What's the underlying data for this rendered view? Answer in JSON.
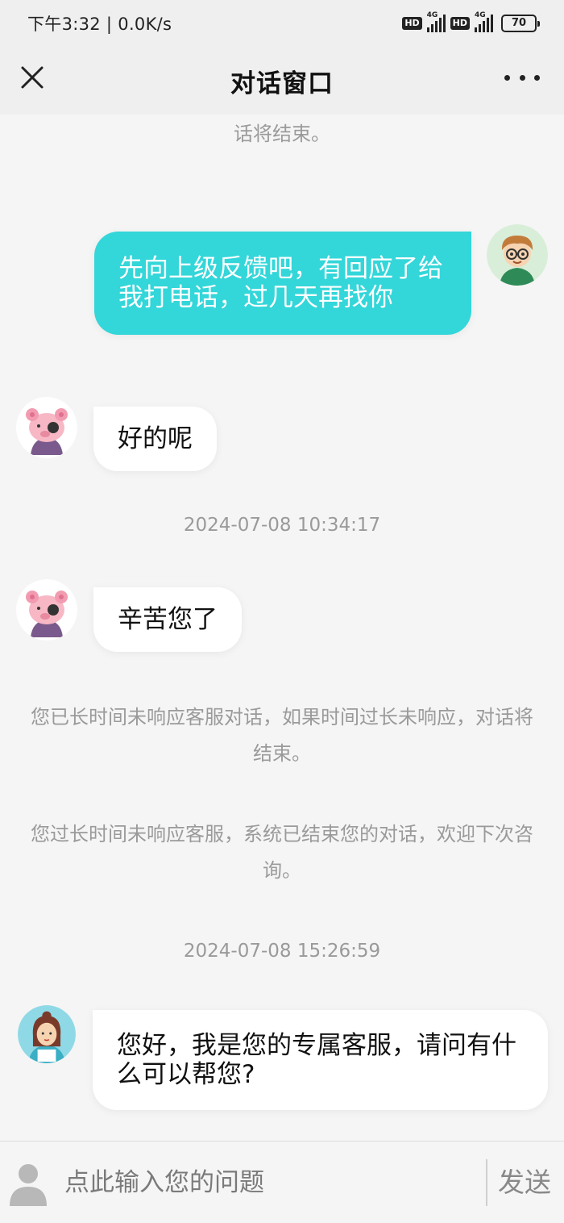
{
  "status_bar": {
    "time_speed": "下午3:32 | 0.0K/s",
    "hd_label": "HD",
    "network_label": "4G",
    "battery": "70"
  },
  "header": {
    "title": "对话窗口",
    "close_icon": "close-icon",
    "more_icon": "more-dots-icon"
  },
  "messages": {
    "sys_top": "话将结束。",
    "mine_1": "先向上级反馈吧，有回应了给我打电话，过几天再找你",
    "theirs_1": "好的呢",
    "time_1": "2024-07-08 10:34:17",
    "theirs_2": "辛苦您了",
    "sys_timeout_warning": "您已长时间未响应客服对话，如果时间过长未响应，对话将结束。",
    "sys_ended": "您过长时间未响应客服，系统已结束您的对话，欢迎下次咨询。",
    "time_2": "2024-07-08 15:26:59",
    "agent_greeting": "您好，我是您的专属客服，请问有什么可以帮您?"
  },
  "input": {
    "placeholder": "点此输入您的问题",
    "send_label": "发送"
  },
  "colors": {
    "accent": "#33d6d9",
    "background": "#f5f5f5",
    "header_bg": "#efefef",
    "system_text": "#9a9a9a"
  }
}
